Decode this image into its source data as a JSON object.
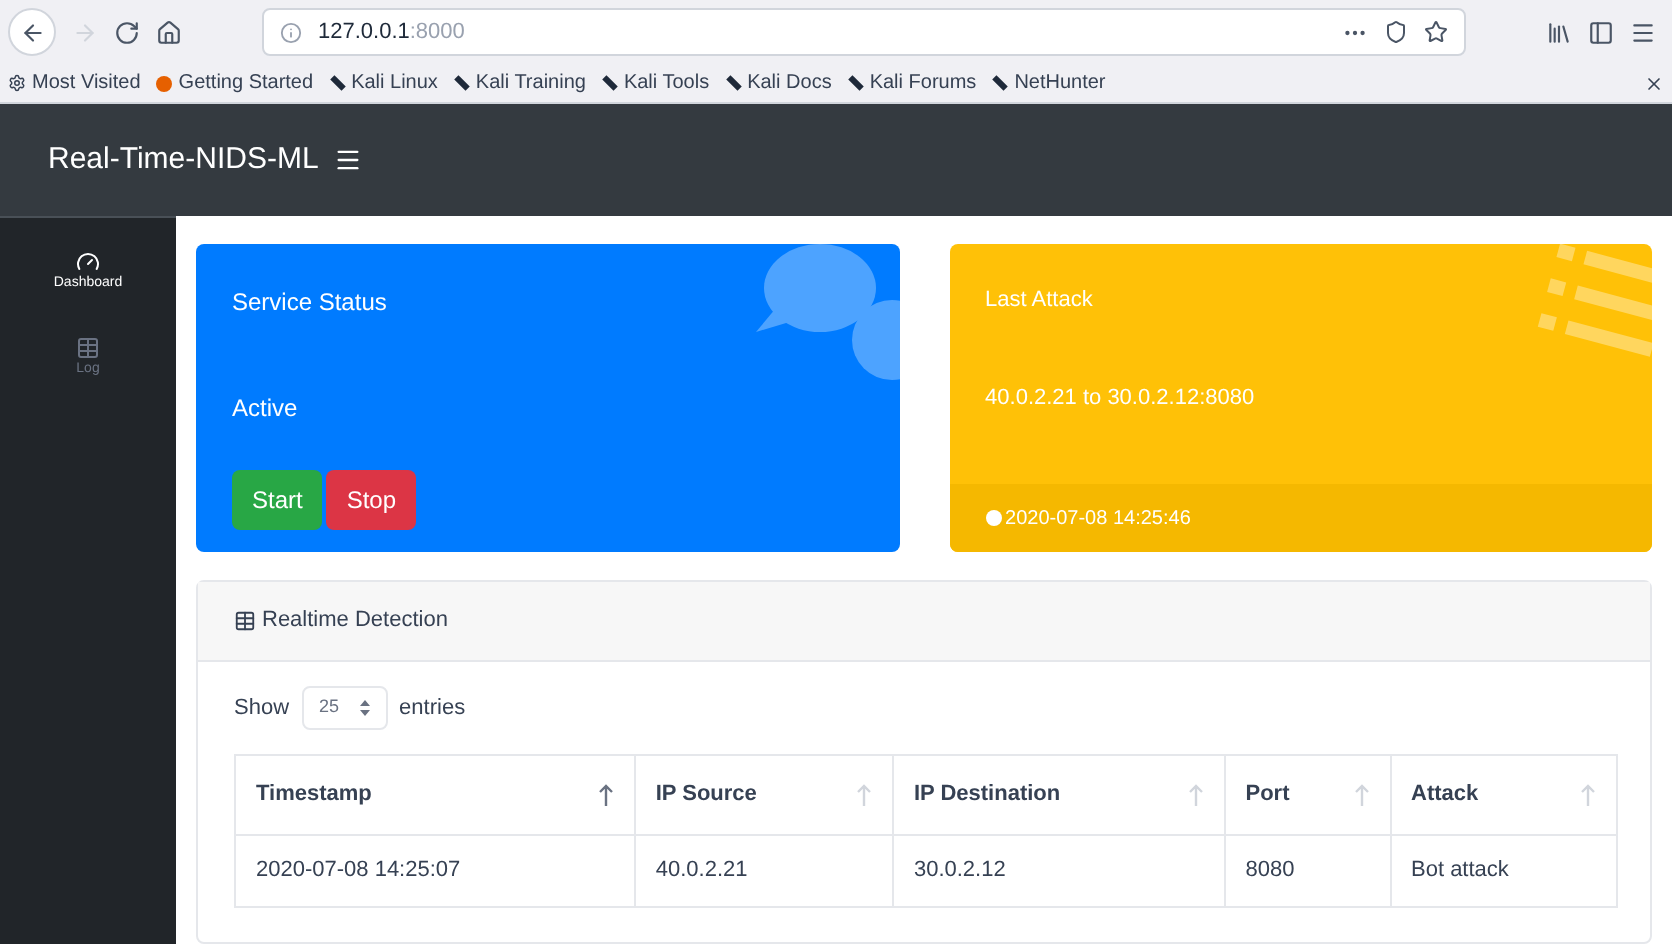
{
  "browser": {
    "url_host": "127.0.0.1",
    "url_port": ":8000",
    "bookmarks": [
      "Most Visited",
      "Getting Started",
      "Kali Linux",
      "Kali Training",
      "Kali Tools",
      "Kali Docs",
      "Kali Forums",
      "NetHunter"
    ]
  },
  "navbar": {
    "brand": "Real-Time-NIDS-ML"
  },
  "sidebar": {
    "items": [
      {
        "label": "Dashboard",
        "kind": "dashboard",
        "selected": true
      },
      {
        "label": "Log",
        "kind": "table",
        "selected": false
      }
    ]
  },
  "service_card": {
    "title": "Service Status",
    "status": "Active",
    "buttons": [
      {
        "label": "Start",
        "kind": "success"
      },
      {
        "label": "Stop",
        "kind": "danger"
      }
    ]
  },
  "attack_card": {
    "title": "Last Attack",
    "detail": "40.0.2.21 to 30.0.2.12:8080",
    "time": "2020-07-08 14:25:46"
  },
  "detection": {
    "title": "Realtime Detection",
    "show_label": "Show",
    "page_size": "25",
    "entries_label": "entries",
    "columns": [
      {
        "label": "Timestamp",
        "sorted": true
      },
      {
        "label": "IP Source",
        "sorted": false
      },
      {
        "label": "IP Destination",
        "sorted": false
      },
      {
        "label": "Port",
        "sorted": false
      },
      {
        "label": "Attack",
        "sorted": false
      }
    ],
    "rows": [
      [
        "2020-07-08 14:25:07",
        "40.0.2.21",
        "30.0.2.12",
        "8080",
        "Bot attack"
      ]
    ]
  }
}
